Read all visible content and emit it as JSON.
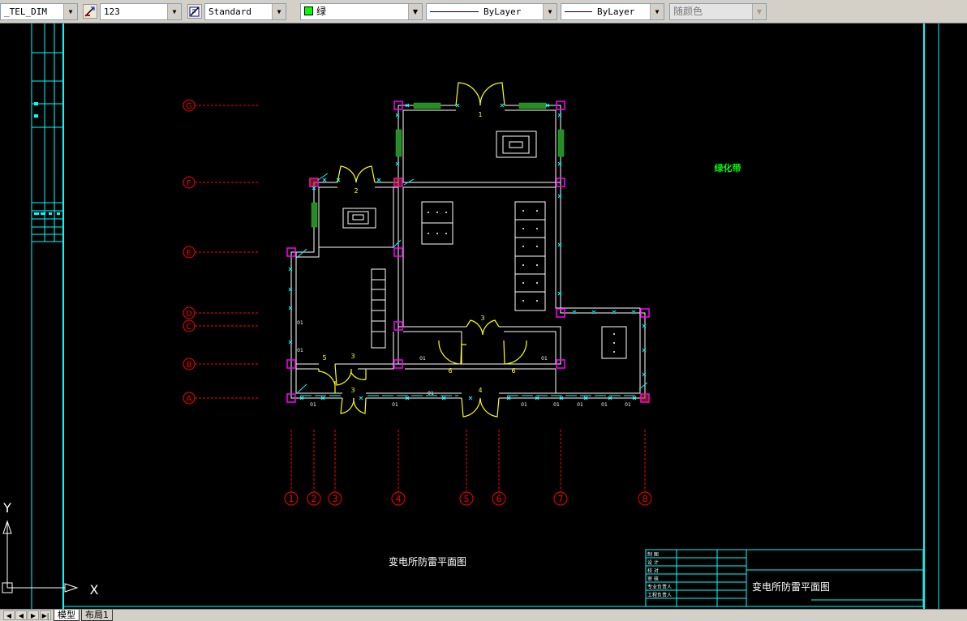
{
  "toolbar": {
    "dim_style": "_TEL_DIM",
    "text_height": "123",
    "text_style": "Standard",
    "color": "绿",
    "linetype": "ByLayer",
    "lineweight": "ByLayer",
    "plot_style": "随颜色"
  },
  "colors": {
    "background": "#000000",
    "wall": "#ffffff",
    "column": "#ff00ff",
    "axis": "#ff0000",
    "door": "#ffff00",
    "window": "#00ffff",
    "green_text": "#00ff00",
    "frame": "#00ffff"
  },
  "drawing": {
    "axis_labels_row": [
      "G",
      "F",
      "E",
      "D",
      "C",
      "B",
      "A"
    ],
    "axis_labels_col": [
      "1",
      "2",
      "3",
      "4",
      "5",
      "6",
      "7",
      "8"
    ],
    "room_numbers": [
      "1",
      "2",
      "3",
      "3",
      "3",
      "4",
      "5",
      "6",
      "6"
    ],
    "window_tags": [
      "01"
    ],
    "green_label": "绿化带",
    "plan_title": "变电所防雷平面图"
  },
  "title_block": {
    "rows": [
      "制 图",
      "设 计",
      "校 对",
      "审 核",
      "专业负责人",
      "工程负责人"
    ],
    "title": "变电所防雷平面图"
  },
  "ucs": {
    "y_label": "Y",
    "x_label": "X"
  },
  "layout_tabs": {
    "model": "模型",
    "layout1": "布局1"
  },
  "nav": {
    "first": "◀",
    "prev": "◀",
    "next": "▶",
    "last": "▶|"
  }
}
